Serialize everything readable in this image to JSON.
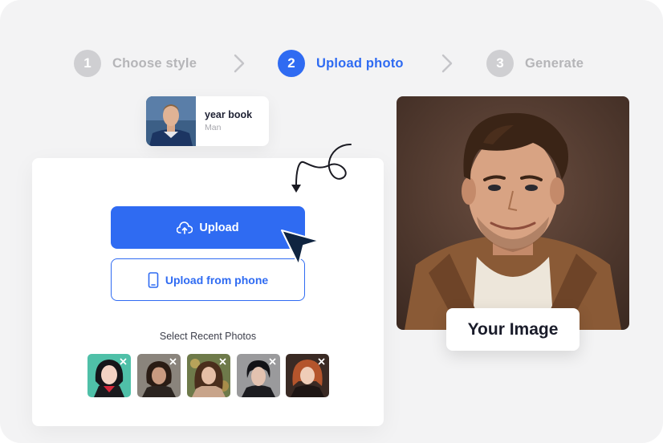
{
  "steps": [
    {
      "number": "1",
      "label": "Choose style",
      "state": "inactive"
    },
    {
      "number": "2",
      "label": "Upload photo",
      "state": "active"
    },
    {
      "number": "3",
      "label": "Generate",
      "state": "inactive"
    }
  ],
  "selected_style": {
    "title": "year book",
    "subtitle": "Man"
  },
  "upload": {
    "upload_label": "Upload",
    "phone_label": "Upload from phone",
    "recent_label": "Select Recent Photos",
    "recent_photos_count": 5
  },
  "preview": {
    "label": "Your Image"
  },
  "colors": {
    "accent": "#2f6bf2",
    "background": "#f3f3f4",
    "inactive": "#cfcfd2"
  },
  "icons": [
    "chevron-right-icon",
    "cloud-upload-icon",
    "phone-icon",
    "close-icon",
    "cursor-icon",
    "curly-arrow-icon"
  ]
}
